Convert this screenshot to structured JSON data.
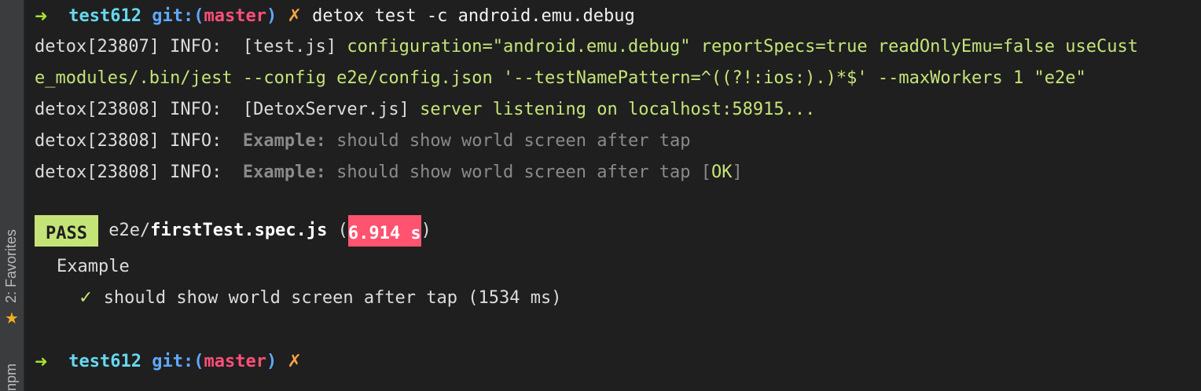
{
  "sidebar": {
    "favorites_label": "2: Favorites",
    "npm_label": "npm"
  },
  "prompt": {
    "arrow": "➜",
    "dir": "test612",
    "git_prefix": "git:(",
    "branch": "master",
    "git_suffix": ")",
    "dirty_mark": "✗"
  },
  "lines": {
    "cmd": "detox test -c android.emu.debug",
    "l1_prefix": "detox[23807] INFO:  ",
    "l1_tag": "[test.js]",
    "l1_msg": " configuration=\"android.emu.debug\" reportSpecs=true readOnlyEmu=false useCust",
    "l2": "e_modules/.bin/jest --config e2e/config.json '--testNamePattern=^((?!:ios:).)*$' --maxWorkers 1 \"e2e\"",
    "l3_prefix": "detox[23808] INFO:  ",
    "l3_tag": "[DetoxServer.js]",
    "l3_msg": " server listening on localhost:58915...",
    "l4_prefix": "detox[23808] INFO:  ",
    "l4_suite": "Example:",
    "l4_msg": " should show world screen after tap",
    "l5_prefix": "detox[23808] INFO:  ",
    "l5_suite": "Example:",
    "l5_msg": " should show world screen after tap ",
    "l5_open": "[",
    "l5_ok": "OK",
    "l5_close": "]"
  },
  "result": {
    "status": "PASS",
    "path_dir": "e2e/",
    "path_file": "firstTest.spec.js",
    "time_open": "(",
    "time": "6.914 s",
    "time_close": ")",
    "suite": "Example",
    "check": "✓",
    "test_name": "should show world screen after tap (1534 ms)"
  },
  "colors": {
    "background": "#1f1f1f",
    "pass_badge": "#c5e478",
    "time_badge": "#ff5370",
    "branch": "#ff4f7a",
    "dir": "#66d9ef"
  }
}
